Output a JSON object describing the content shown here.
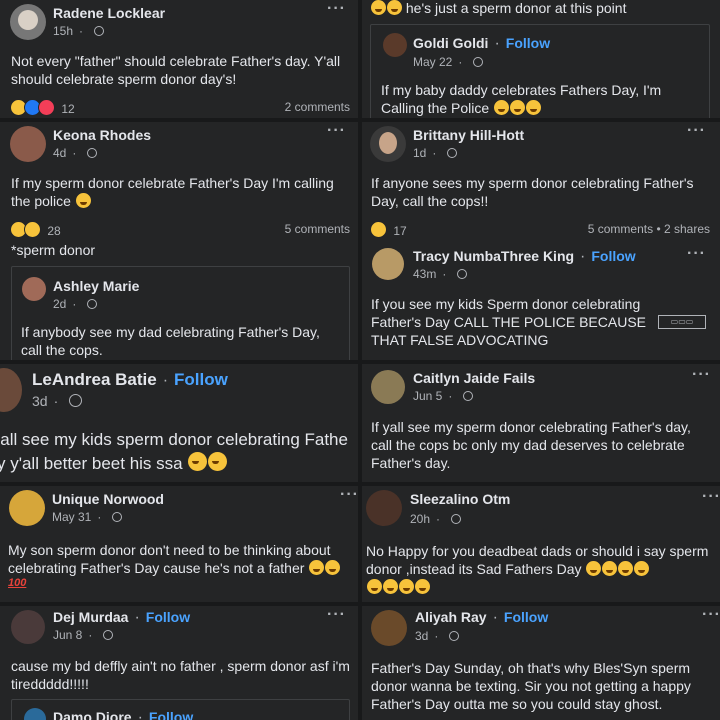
{
  "p1": {
    "name": "Radene Locklear",
    "time": "15h",
    "text": "Not every \"father\" should celebrate Father's day. Y'all should celebrate sperm donor day's!",
    "reactions": "12",
    "comments": "2 comments"
  },
  "p2": {
    "top_text": "he's just a sperm donor at this point",
    "name": "Goldi Goldi",
    "follow": "Follow",
    "time": "May 22",
    "text": "If my baby daddy celebrates Fathers Day, I'm Calling the Police"
  },
  "p3": {
    "name": "Keona Rhodes",
    "time": "4d",
    "text": "If my sperm donor celebrate Father's Day I'm calling the police",
    "reactions": "28",
    "comments": "5 comments",
    "caption": "*sperm donor",
    "q_name": "Ashley Marie",
    "q_time": "2d",
    "q_text": "If anybody see my dad celebrating Father's Day, call the cops."
  },
  "p4": {
    "name": "Brittany Hill-Hott",
    "time": "1d",
    "text": "If anyone sees my sperm donor celebrating Father's Day, call the cops!!",
    "reactions": "17",
    "comments": "5 comments • 2 shares",
    "q_name": "Tracy NumbaThree King",
    "q_follow": "Follow",
    "q_time": "43m",
    "q_text": "If you see my kids Sperm donor celebrating Father's Day CALL THE POLICE BECAUSE THAT FALSE ADVOCATING"
  },
  "p5": {
    "name": "LeAndrea Batie",
    "follow": "Follow",
    "time": "3d",
    "line1": "'all see my kids sperm donor celebrating Fathe",
    "line2": "y y'all better beet his ssa"
  },
  "p6": {
    "name": "Caitlyn Jaide Fails",
    "time": "Jun 5",
    "text": "If yall see my sperm donor celebrating Father's day, call the cops bc only my dad deserves to celebrate Father's day."
  },
  "p7": {
    "name": "Unique Norwood",
    "time": "May 31",
    "text": "My son sperm donor don't need to be thinking about celebrating Father's Day cause he's not a father",
    "badge": "100"
  },
  "p8": {
    "name": "Sleezalino Otm",
    "time": "20h",
    "text": "No Happy for you deadbeat dads or should i say sperm donor ,instead its Sad Fathers Day"
  },
  "p9": {
    "name": "Dej Murdaa",
    "follow": "Follow",
    "time": "Jun 8",
    "text": "cause my bd deffly ain't no father , sperm donor asf i'm tireddddd!!!!!",
    "q_name": "Damo Diore",
    "q_follow": "Follow"
  },
  "p10": {
    "name": "Aliyah Ray",
    "follow": "Follow",
    "time": "3d",
    "text": "Father's Day Sunday, oh that's why Bles'Syn sperm donor wanna be texting. Sir you not getting a happy Father's Day outta me so you could stay ghost."
  },
  "colors": {
    "background": "#242526",
    "link": "#4aa3ff",
    "muted": "#b0b3b8"
  }
}
